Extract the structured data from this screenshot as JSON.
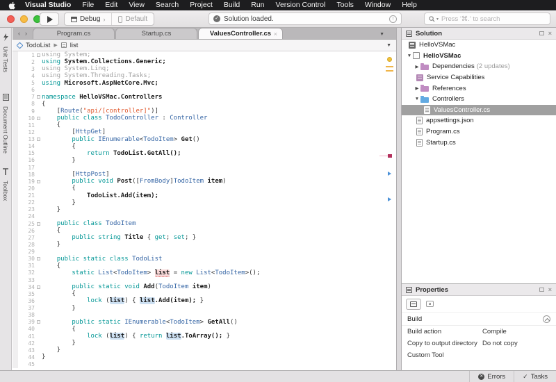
{
  "menu_bar": {
    "app": "Visual Studio",
    "items": [
      "File",
      "Edit",
      "View",
      "Search",
      "Project",
      "Build",
      "Run",
      "Version Control",
      "Tools",
      "Window",
      "Help"
    ]
  },
  "toolbar": {
    "config": "Debug",
    "target": "Default",
    "status": "Solution loaded.",
    "search_placeholder": "Press '⌘.' to search"
  },
  "side_strip": {
    "items": [
      {
        "label": "Unit Tests",
        "icon": "lightning-icon"
      },
      {
        "label": "Document Outline",
        "icon": "document-icon"
      },
      {
        "label": "Toolbox",
        "icon": "tsquare-icon"
      }
    ]
  },
  "tabs": [
    {
      "label": "Program.cs",
      "active": false
    },
    {
      "label": "Startup.cs",
      "active": false
    },
    {
      "label": "ValuesController.cs",
      "active": true
    }
  ],
  "breadcrumb": {
    "items": [
      {
        "label": "TodoList",
        "icon": "class-icon"
      },
      {
        "label": "list",
        "icon": "field-icon"
      }
    ]
  },
  "editor": {
    "fold_lines": [
      1,
      7,
      10,
      13,
      19,
      25,
      30,
      34,
      39
    ],
    "lines": [
      [
        [
          "g",
          "using System;"
        ]
      ],
      [
        [
          "k",
          "using"
        ],
        [
          "b",
          " System.Collections.Generic;"
        ]
      ],
      [
        [
          "g",
          "using System.Linq;"
        ]
      ],
      [
        [
          "g",
          "using System.Threading.Tasks;"
        ]
      ],
      [
        [
          "k",
          "using"
        ],
        [
          "b",
          " Microsoft.AspNetCore.Mvc;"
        ]
      ],
      [],
      [
        [
          "k",
          "namespace"
        ],
        [
          "b",
          " HelloVSMac.Controllers"
        ]
      ],
      [
        [
          "p",
          "{"
        ]
      ],
      [
        [
          "p",
          "    ["
        ],
        [
          "t",
          "Route"
        ],
        [
          "p",
          "("
        ],
        [
          "s",
          "\"api/[controller]\""
        ],
        [
          "p",
          ")]"
        ]
      ],
      [
        [
          "p",
          "    "
        ],
        [
          "k",
          "public"
        ],
        [
          "p",
          " "
        ],
        [
          "k",
          "class"
        ],
        [
          "t",
          " TodoController"
        ],
        [
          "p",
          " : "
        ],
        [
          "t",
          "Controller"
        ]
      ],
      [
        [
          "p",
          "    {"
        ]
      ],
      [
        [
          "p",
          "        ["
        ],
        [
          "t",
          "HttpGet"
        ],
        [
          "p",
          "]"
        ]
      ],
      [
        [
          "p",
          "        "
        ],
        [
          "k",
          "public"
        ],
        [
          "t",
          " IEnumerable"
        ],
        [
          "p",
          "<"
        ],
        [
          "t",
          "TodoItem"
        ],
        [
          "p",
          "> "
        ],
        [
          "b",
          "Get"
        ],
        [
          "p",
          "()"
        ]
      ],
      [
        [
          "p",
          "        {"
        ]
      ],
      [
        [
          "p",
          "            "
        ],
        [
          "k",
          "return"
        ],
        [
          "b",
          " TodoList.GetAll();"
        ]
      ],
      [
        [
          "p",
          "        }"
        ]
      ],
      [],
      [
        [
          "p",
          "        ["
        ],
        [
          "t",
          "HttpPost"
        ],
        [
          "p",
          "]"
        ]
      ],
      [
        [
          "p",
          "        "
        ],
        [
          "k",
          "public"
        ],
        [
          "p",
          " "
        ],
        [
          "k",
          "void"
        ],
        [
          "b",
          " Post"
        ],
        [
          "p",
          "(["
        ],
        [
          "t",
          "FromBody"
        ],
        [
          "p",
          "]"
        ],
        [
          "t",
          "TodoItem"
        ],
        [
          "b",
          " item"
        ],
        [
          "p",
          ")"
        ]
      ],
      [
        [
          "p",
          "        {"
        ]
      ],
      [
        [
          "p",
          "            "
        ],
        [
          "b",
          "TodoList.Add(item);"
        ]
      ],
      [
        [
          "p",
          "        }"
        ]
      ],
      [
        [
          "p",
          "    }"
        ]
      ],
      [],
      [
        [
          "p",
          "    "
        ],
        [
          "k",
          "public"
        ],
        [
          "p",
          " "
        ],
        [
          "k",
          "class"
        ],
        [
          "t",
          " TodoItem"
        ]
      ],
      [
        [
          "p",
          "    {"
        ]
      ],
      [
        [
          "p",
          "        "
        ],
        [
          "k",
          "public"
        ],
        [
          "p",
          " "
        ],
        [
          "k",
          "string"
        ],
        [
          "b",
          " Title"
        ],
        [
          "p",
          " { "
        ],
        [
          "k",
          "get"
        ],
        [
          "p",
          "; "
        ],
        [
          "k",
          "set"
        ],
        [
          "p",
          "; }"
        ]
      ],
      [
        [
          "p",
          "    }"
        ]
      ],
      [],
      [
        [
          "p",
          "    "
        ],
        [
          "k",
          "public"
        ],
        [
          "p",
          " "
        ],
        [
          "k",
          "static"
        ],
        [
          "p",
          " "
        ],
        [
          "k",
          "class"
        ],
        [
          "t",
          " TodoList"
        ]
      ],
      [
        [
          "p",
          "    {"
        ]
      ],
      [
        [
          "p",
          "        "
        ],
        [
          "k",
          "static"
        ],
        [
          "t",
          " List"
        ],
        [
          "p",
          "<"
        ],
        [
          "t",
          "TodoItem"
        ],
        [
          "p",
          "> "
        ],
        [
          "hp",
          "list"
        ],
        [
          "p",
          " = "
        ],
        [
          "k",
          "new"
        ],
        [
          "t",
          " List"
        ],
        [
          "p",
          "<"
        ],
        [
          "t",
          "TodoItem"
        ],
        [
          "p",
          ">();"
        ]
      ],
      [],
      [
        [
          "p",
          "        "
        ],
        [
          "k",
          "public"
        ],
        [
          "p",
          " "
        ],
        [
          "k",
          "static"
        ],
        [
          "p",
          " "
        ],
        [
          "k",
          "void"
        ],
        [
          "b",
          " Add"
        ],
        [
          "p",
          "("
        ],
        [
          "t",
          "TodoItem"
        ],
        [
          "b",
          " item"
        ],
        [
          "p",
          ")"
        ]
      ],
      [
        [
          "p",
          "        {"
        ]
      ],
      [
        [
          "p",
          "            "
        ],
        [
          "k",
          "lock"
        ],
        [
          "p",
          " ("
        ],
        [
          "hb",
          "list"
        ],
        [
          "p",
          ") { "
        ],
        [
          "hb",
          "list"
        ],
        [
          "b",
          ".Add(item);"
        ],
        [
          "p",
          " }"
        ]
      ],
      [
        [
          "p",
          "        }"
        ]
      ],
      [],
      [
        [
          "p",
          "        "
        ],
        [
          "k",
          "public"
        ],
        [
          "p",
          " "
        ],
        [
          "k",
          "static"
        ],
        [
          "t",
          " IEnumerable"
        ],
        [
          "p",
          "<"
        ],
        [
          "t",
          "TodoItem"
        ],
        [
          "p",
          "> "
        ],
        [
          "b",
          "GetAll"
        ],
        [
          "p",
          "()"
        ]
      ],
      [
        [
          "p",
          "        {"
        ]
      ],
      [
        [
          "p",
          "            "
        ],
        [
          "k",
          "lock"
        ],
        [
          "p",
          " ("
        ],
        [
          "hb",
          "list"
        ],
        [
          "p",
          ") { "
        ],
        [
          "k",
          "return"
        ],
        [
          "p",
          " "
        ],
        [
          "hb",
          "list"
        ],
        [
          "b",
          ".ToArray();"
        ],
        [
          "p",
          " }"
        ]
      ],
      [
        [
          "p",
          "        }"
        ]
      ],
      [
        [
          "p",
          "    }"
        ]
      ],
      [
        [
          "p",
          "}"
        ]
      ],
      []
    ]
  },
  "solution_pad": {
    "title": "Solution",
    "tree": [
      {
        "label": "HelloVSMac",
        "icon": "solution",
        "indent": 0,
        "expander": "none",
        "bold": false,
        "selected": false,
        "suffix": ""
      },
      {
        "label": "HelloVSMac",
        "icon": "project",
        "indent": 0,
        "expander": "down",
        "bold": true,
        "selected": false,
        "suffix": ""
      },
      {
        "label": "Dependencies",
        "icon": "folder-purple",
        "indent": 1,
        "expander": "right",
        "bold": false,
        "selected": false,
        "suffix": "(2 updates)"
      },
      {
        "label": "Service Capabilities",
        "icon": "capabilities",
        "indent": 1,
        "expander": "none",
        "bold": false,
        "selected": false,
        "suffix": ""
      },
      {
        "label": "References",
        "icon": "folder-purple",
        "indent": 1,
        "expander": "right",
        "bold": false,
        "selected": false,
        "suffix": ""
      },
      {
        "label": "Controllers",
        "icon": "folder-blue",
        "indent": 1,
        "expander": "down",
        "bold": false,
        "selected": false,
        "suffix": ""
      },
      {
        "label": "ValuesController.cs",
        "icon": "file-cs",
        "indent": 2,
        "expander": "none",
        "bold": false,
        "selected": true,
        "suffix": ""
      },
      {
        "label": "appsettings.json",
        "icon": "file-json",
        "indent": 1,
        "expander": "none",
        "bold": false,
        "selected": false,
        "suffix": ""
      },
      {
        "label": "Program.cs",
        "icon": "file-cs",
        "indent": 1,
        "expander": "none",
        "bold": false,
        "selected": false,
        "suffix": ""
      },
      {
        "label": "Startup.cs",
        "icon": "file-cs",
        "indent": 1,
        "expander": "none",
        "bold": false,
        "selected": false,
        "suffix": ""
      }
    ]
  },
  "properties_pad": {
    "title": "Properties",
    "section": "Build",
    "rows": [
      {
        "label": "Build action",
        "value": "Compile"
      },
      {
        "label": "Copy to output directory",
        "value": "Do not copy"
      },
      {
        "label": "Custom Tool",
        "value": ""
      }
    ]
  },
  "status_bar": {
    "errors": "Errors",
    "tasks": "Tasks"
  },
  "colors": {
    "menubar_bg": "#1d1d1f",
    "keyword": "#009695",
    "type": "#3364a4",
    "string": "#e0592e",
    "unused": "#a0a0a0",
    "selection_row": "#a0a0a0",
    "folder_blue": "#62aae2",
    "folder_purple": "#c08cc2",
    "marker_yellow": "#f0c33c",
    "marker_red": "#b3305c",
    "marker_blue": "#4a90d8",
    "traffic_red": "#f45f56",
    "traffic_yellow": "#f8bd44",
    "traffic_green": "#3cc23c"
  }
}
